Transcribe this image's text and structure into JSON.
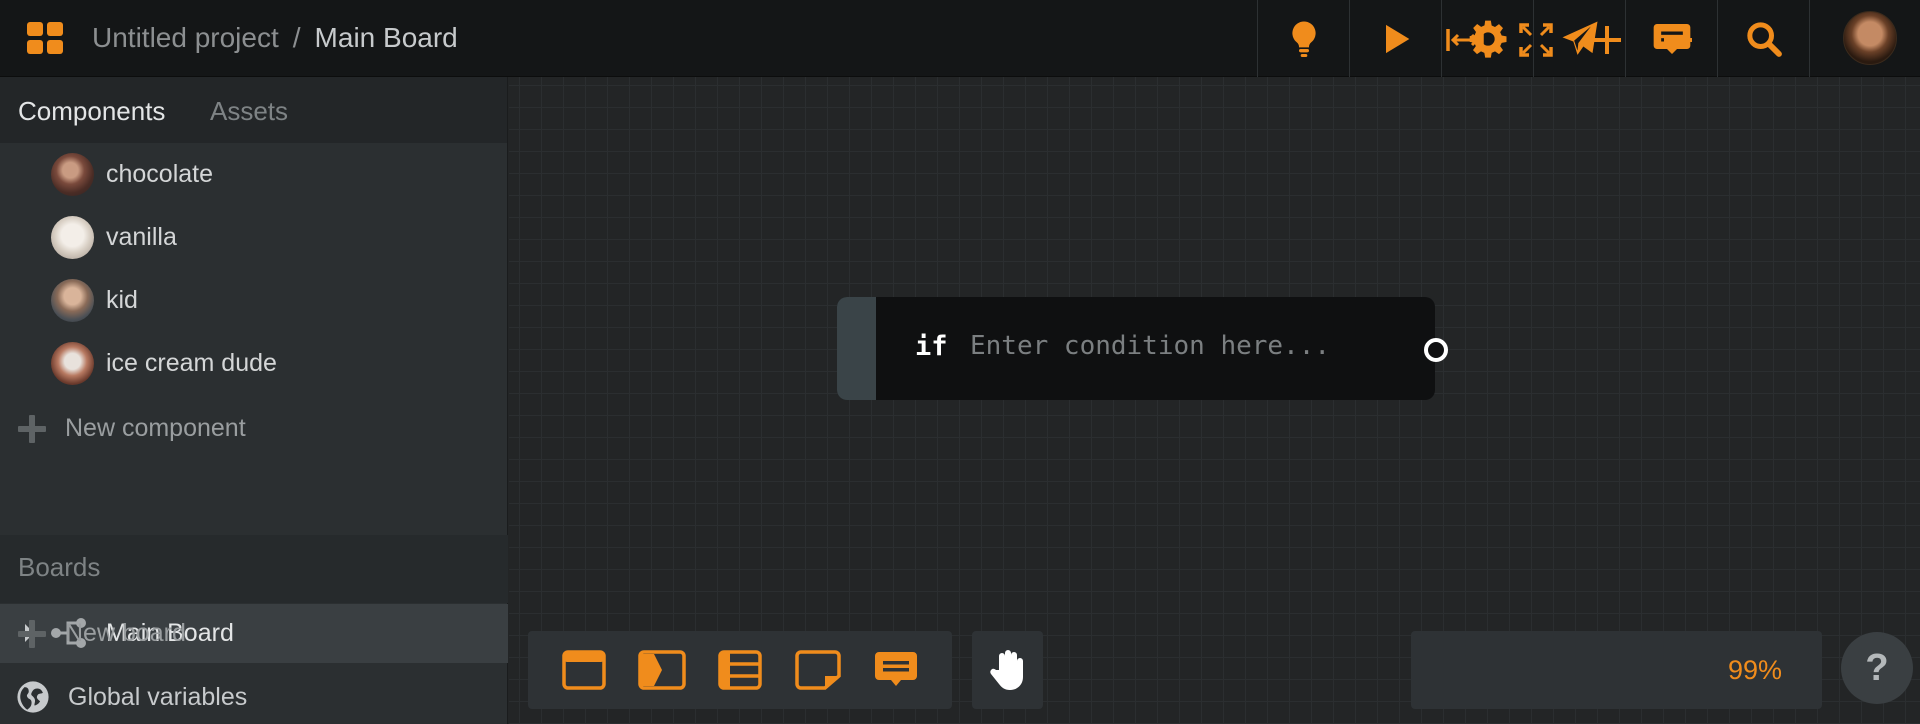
{
  "header": {
    "project_name": "Untitled project",
    "separator": "/",
    "board_name": "Main Board",
    "actions": [
      {
        "name": "ideas",
        "icon": "lightbulb-icon"
      },
      {
        "name": "play",
        "icon": "play-icon"
      },
      {
        "name": "settings",
        "icon": "gear-icon"
      },
      {
        "name": "share",
        "icon": "paper-plane-icon"
      },
      {
        "name": "comments",
        "icon": "comment-icon"
      },
      {
        "name": "search",
        "icon": "search-icon"
      }
    ],
    "accent_color": "#f08c1c"
  },
  "sidebar": {
    "tabs": [
      {
        "label": "Components",
        "active": true
      },
      {
        "label": "Assets",
        "active": false
      }
    ],
    "components": [
      {
        "label": "chocolate"
      },
      {
        "label": "vanilla"
      },
      {
        "label": "kid"
      },
      {
        "label": "ice cream dude"
      }
    ],
    "new_component_label": "New component",
    "boards_heading": "Boards",
    "boards": [
      {
        "label": "Main Board",
        "selected": true
      }
    ],
    "new_board_label": "New board",
    "global_variables_label": "Global variables"
  },
  "canvas": {
    "node": {
      "keyword": "if",
      "placeholder": "Enter condition here..."
    },
    "tools": [
      {
        "name": "window-node",
        "icon": "window-icon"
      },
      {
        "name": "choice-node",
        "icon": "choice-icon"
      },
      {
        "name": "list-node",
        "icon": "list-icon"
      },
      {
        "name": "note-node",
        "icon": "sticky-note-icon"
      },
      {
        "name": "comment-node",
        "icon": "comment-icon"
      }
    ],
    "zoom_level": "99%",
    "help_label": "?"
  }
}
